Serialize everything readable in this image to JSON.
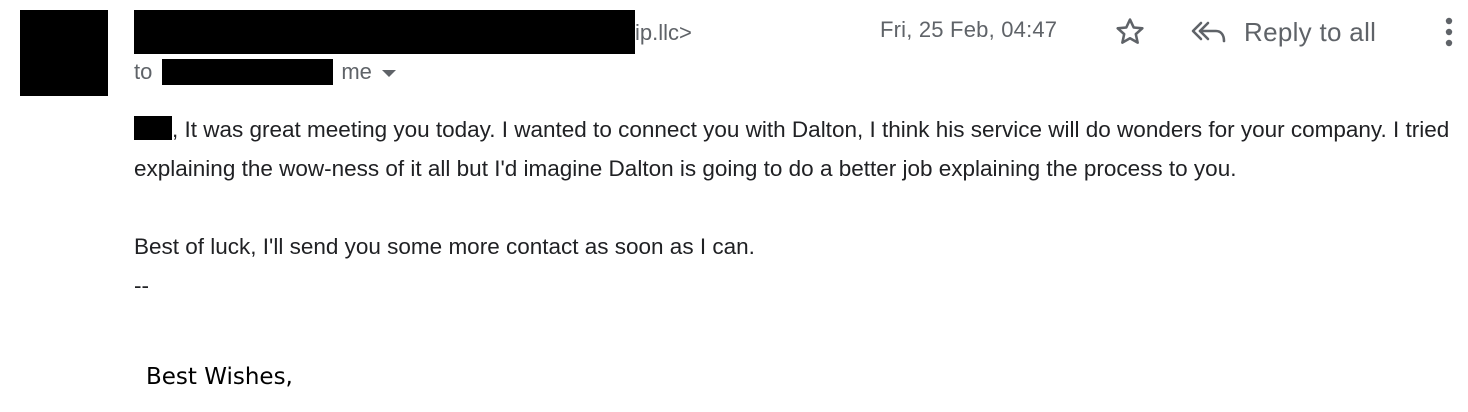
{
  "sender": {
    "visible_tail": "ip.llc>"
  },
  "header": {
    "timestamp": "Fri, 25 Feb, 04:47",
    "reply_all_label": "Reply to all"
  },
  "recipients": {
    "to_label": "to",
    "me_label": "me"
  },
  "message": {
    "line1_after_redaction": ", It was great meeting you today. I wanted to connect you with Dalton, I think his service will do wonders for your company. I tried explaining the wow-ness of it all but I'd imagine Dalton is going to do a better job explaining the process to you.",
    "line2": "Best of luck, I'll send you some more contact as soon as I can.",
    "separator": "--",
    "signature": "Best Wishes,"
  },
  "icons": {
    "star": "star-outline-icon",
    "reply_all": "reply-all-icon",
    "more": "more-vertical-icon"
  },
  "colors": {
    "muted_text": "#5f6368",
    "body_text": "#202124",
    "redaction": "#000000"
  }
}
